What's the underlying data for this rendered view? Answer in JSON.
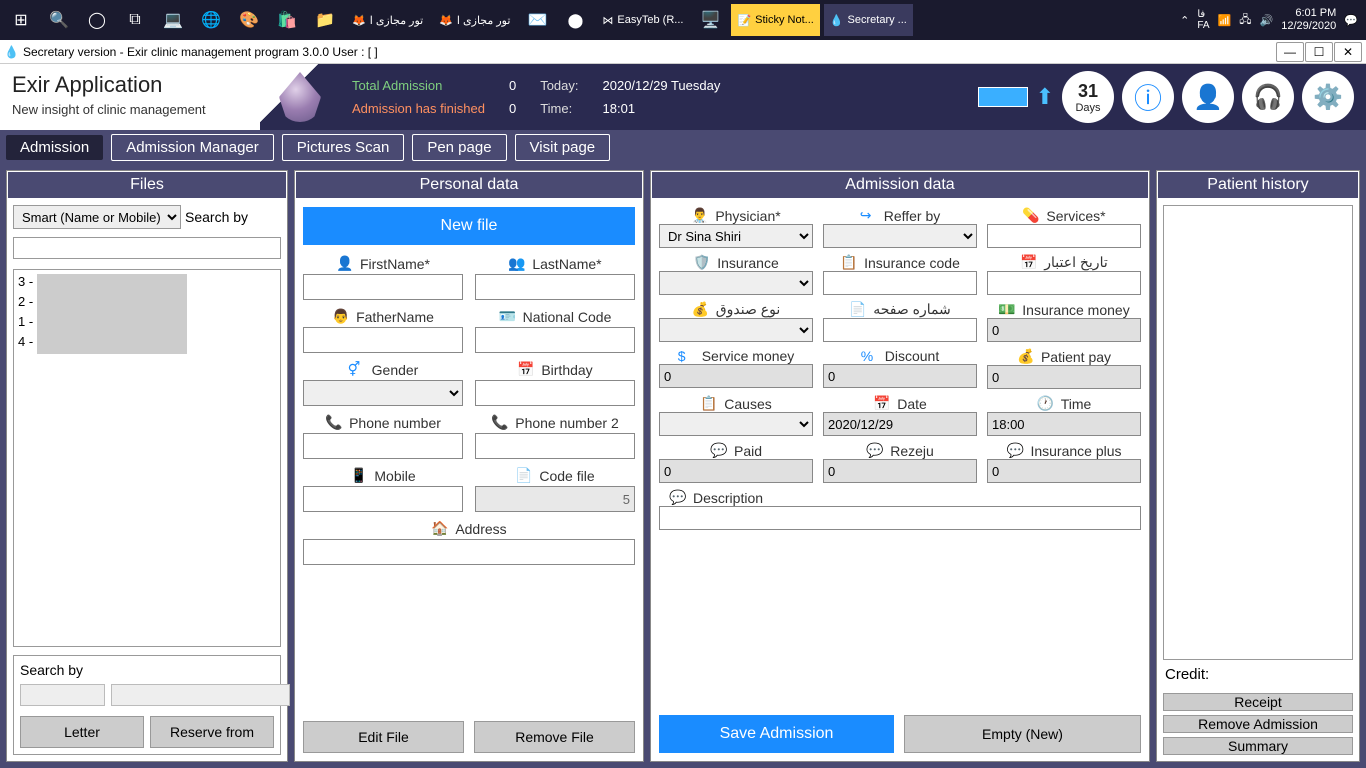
{
  "taskbar": {
    "apps": [
      "تور مجازی ا",
      "تور مجازی ا",
      "EasyTeb (R...",
      "Sticky Not...",
      "Secretary ..."
    ],
    "lang": "فا\nFA",
    "time": "6:01 PM",
    "date": "12/29/2020"
  },
  "titlebar": {
    "title": "Secretary version - Exir clinic management program 3.0.0 User : [ ]"
  },
  "header": {
    "app_title": "Exir Application",
    "app_subtitle": "New insight of clinic management",
    "total_admission_label": "Total Admission",
    "total_admission_value": "0",
    "finished_label": "Admission has finished",
    "finished_value": "0",
    "today_label": "Today:",
    "today_value": "2020/12/29  Tuesday",
    "time_label": "Time:",
    "time_value": "18:01",
    "days_num": "31",
    "days_label": "Days"
  },
  "ribbon": {
    "tabs": [
      "Admission",
      "Admission Manager",
      "Pictures  Scan",
      "Pen page",
      "Visit page"
    ]
  },
  "files": {
    "title": "Files",
    "search_by": "Search by",
    "select": "Smart (Name or Mobile)",
    "items": [
      "3 -",
      "2 -",
      "1 -",
      "4 -"
    ],
    "search_by2": "Search by",
    "letter_btn": "Letter",
    "reserve_btn": "Reserve from"
  },
  "personal": {
    "title": "Personal data",
    "new_file": "New file",
    "first_name": "FirstName*",
    "last_name": "LastName*",
    "father": "FatherName",
    "national": "National Code",
    "gender": "Gender",
    "birthday": "Birthday",
    "phone1": "Phone number",
    "phone2": "Phone number 2",
    "mobile": "Mobile",
    "codefile": "Code file",
    "codefile_val": "5",
    "address": "Address",
    "edit_btn": "Edit File",
    "remove_btn": "Remove File"
  },
  "admission": {
    "title": "Admission data",
    "physician": "Physician*",
    "physician_val": "Dr Sina Shiri",
    "reffer": "Reffer by",
    "services": "Services*",
    "insurance": "Insurance",
    "ins_code": "Insurance code",
    "validity": "تاريخ اعتبار",
    "fund_type": "نوع صندوق",
    "page_no": "شماره صفحه",
    "ins_money": "Insurance money",
    "ins_money_val": "0",
    "svc_money": "Service money",
    "svc_money_val": "0",
    "discount": "Discount",
    "discount_val": "0",
    "patient_pay": "Patient pay",
    "patient_pay_val": "0",
    "causes": "Causes",
    "date": "Date",
    "date_val": "2020/12/29",
    "time": "Time",
    "time_val": "18:00",
    "paid": "Paid",
    "paid_val": "0",
    "rezeju": "Rezeju",
    "rezeju_val": "0",
    "ins_plus": "Insurance plus",
    "ins_plus_val": "0",
    "description": "Description",
    "save_btn": "Save Admission",
    "empty_btn": "Empty (New)"
  },
  "history": {
    "title": "Patient history",
    "credit": "Credit:",
    "receipt": "Receipt",
    "remove": "Remove Admission",
    "summary": "Summary"
  }
}
